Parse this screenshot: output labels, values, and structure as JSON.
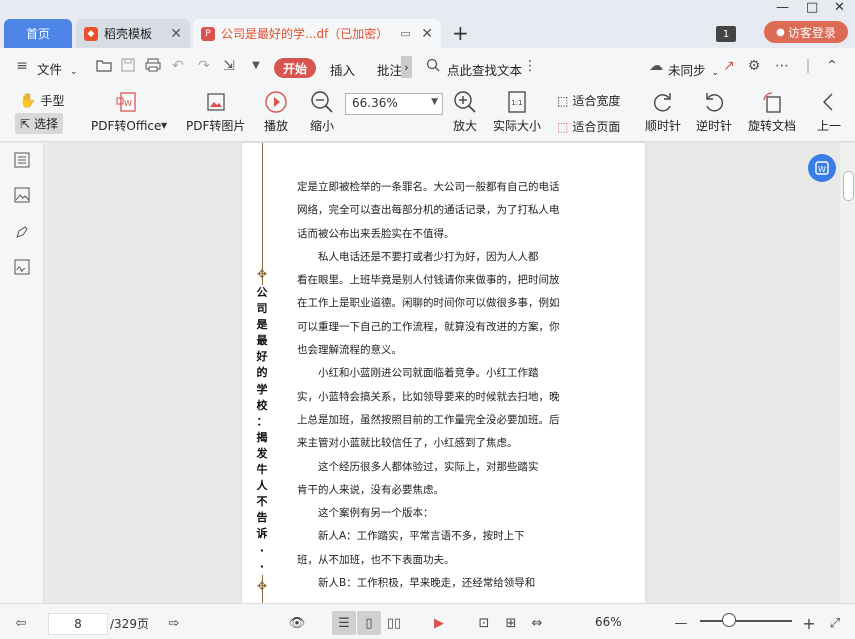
{
  "tabs": {
    "home": "首页",
    "template_tab": "稻壳模板",
    "doc_tab": "公司是最好的学...df（已加密）",
    "new_tab": "+",
    "window_count": "1",
    "login": "访客登录"
  },
  "window_controls": {
    "minimize": "—",
    "maximize": "□",
    "close": "✕"
  },
  "menu": {
    "file": "文件",
    "start": "开始",
    "insert": "插入",
    "annotate": "批注",
    "more": "›",
    "search": "点此查找文本",
    "sync": "未同步"
  },
  "toolbar": {
    "hand": "手型",
    "select": "选择",
    "pdf_to_office": "PDF转Office",
    "pdf_to_image": "PDF转图片",
    "play": "播放",
    "zoom_out": "缩小",
    "zoom_value": "66.36%",
    "zoom_in": "放大",
    "actual_size": "实际大小",
    "fit_width": "适合宽度",
    "fit_page": "适合页面",
    "rotate_cw": "顺时针",
    "rotate_ccw": "逆时针",
    "rotate_doc": "旋转文档",
    "prev": "上一"
  },
  "document": {
    "vertical_title": [
      "公",
      "司",
      "是",
      "最",
      "好",
      "的",
      "学",
      "校",
      "：",
      "揭",
      "发",
      "牛",
      "人",
      "不",
      "告",
      "诉",
      "·",
      "·"
    ],
    "paragraphs": [
      {
        "indent": false,
        "text": "定是立即被检举的一条罪名。大公司一般都有自己的电话"
      },
      {
        "indent": false,
        "text": "网络，完全可以查出每部分机的通话记录，为了打私人电"
      },
      {
        "indent": false,
        "text": "话而被公布出来丢脸实在不值得。"
      },
      {
        "indent": true,
        "text": "私人电话还是不要打或者少打为好，因为人人都"
      },
      {
        "indent": false,
        "text": "看在眼里。上班毕竟是别人付钱请你来做事的，把时间放"
      },
      {
        "indent": false,
        "text": "在工作上是职业道德。闲聊的时间你可以做很多事，例如"
      },
      {
        "indent": false,
        "text": "可以重理一下自己的工作流程，就算没有改进的方案，你"
      },
      {
        "indent": false,
        "text": "也会理解流程的意义。"
      },
      {
        "indent": true,
        "text": "小红和小蓝刚进公司就面临着竞争。小红工作踏"
      },
      {
        "indent": false,
        "text": "实，小蓝特会搞关系，比如领导要来的时候就去扫地，晚"
      },
      {
        "indent": false,
        "text": "上总是加班，虽然按照目前的工作量完全没必要加班。后"
      },
      {
        "indent": false,
        "text": "来主管对小蓝就比较信任了，小红感到了焦虑。"
      },
      {
        "indent": true,
        "text": "这个经历很多人都体验过，实际上，对那些踏实"
      },
      {
        "indent": false,
        "text": "肯干的人来说，没有必要焦虑。"
      },
      {
        "indent": true,
        "text": "这个案例有另一个版本："
      },
      {
        "indent": true,
        "text": "新人A：工作踏实，平常言语不多，按时上下"
      },
      {
        "indent": false,
        "text": "班，从不加班，也不下表面功夫。"
      },
      {
        "indent": true,
        "text": "新人B：工作积极，早来晚走，还经常给领导和"
      }
    ]
  },
  "status": {
    "current_page": "8",
    "total_pages": "/329页",
    "zoom_percent": "66%"
  },
  "colors": {
    "accent_blue": "#4e86e8",
    "start_red": "#d9534f",
    "login_red": "#dd6a55",
    "ornament_brown": "#8c6a3c"
  }
}
